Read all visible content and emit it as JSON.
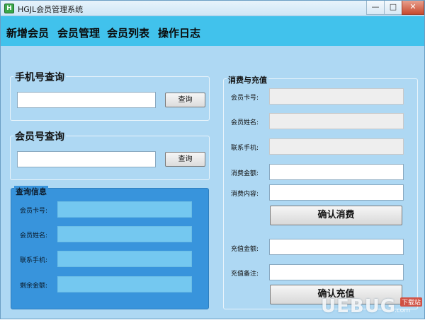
{
  "window": {
    "title": "HGJL会员管理系统",
    "icon": "app-icon",
    "controls": {
      "minimize": "—",
      "maximize": "□",
      "close": "✕"
    }
  },
  "menu": {
    "items": [
      "新增会员",
      "会员管理",
      "会员列表",
      "操作日志"
    ]
  },
  "phone_query": {
    "title": "手机号查询",
    "input_value": "",
    "button": "查询"
  },
  "member_query": {
    "title": "会员号查询",
    "input_value": "",
    "button": "查询"
  },
  "query_info": {
    "title": "查询信息",
    "fields": [
      {
        "label": "会员卡号:",
        "value": ""
      },
      {
        "label": "会员姓名:",
        "value": ""
      },
      {
        "label": "联系手机:",
        "value": ""
      },
      {
        "label": "剩余金额:",
        "value": ""
      }
    ]
  },
  "consume_recharge": {
    "title": "消费与充值",
    "card_label": "会员卡号:",
    "name_label": "会员姓名:",
    "phone_label": "联系手机:",
    "amount_label": "消费金额:",
    "content_label": "消费内容:",
    "confirm_consume": "确认消费",
    "recharge_amount_label": "充值金额:",
    "recharge_note_label": "充值备注:",
    "confirm_recharge": "确认充值"
  },
  "watermark": {
    "text": "UEBUG",
    "badge": "下载站",
    "small": ".com"
  },
  "colors": {
    "background": "#aed8f3",
    "menubar": "#41c2ec",
    "info_panel": "#3894dc",
    "info_field": "#74c8f0"
  }
}
